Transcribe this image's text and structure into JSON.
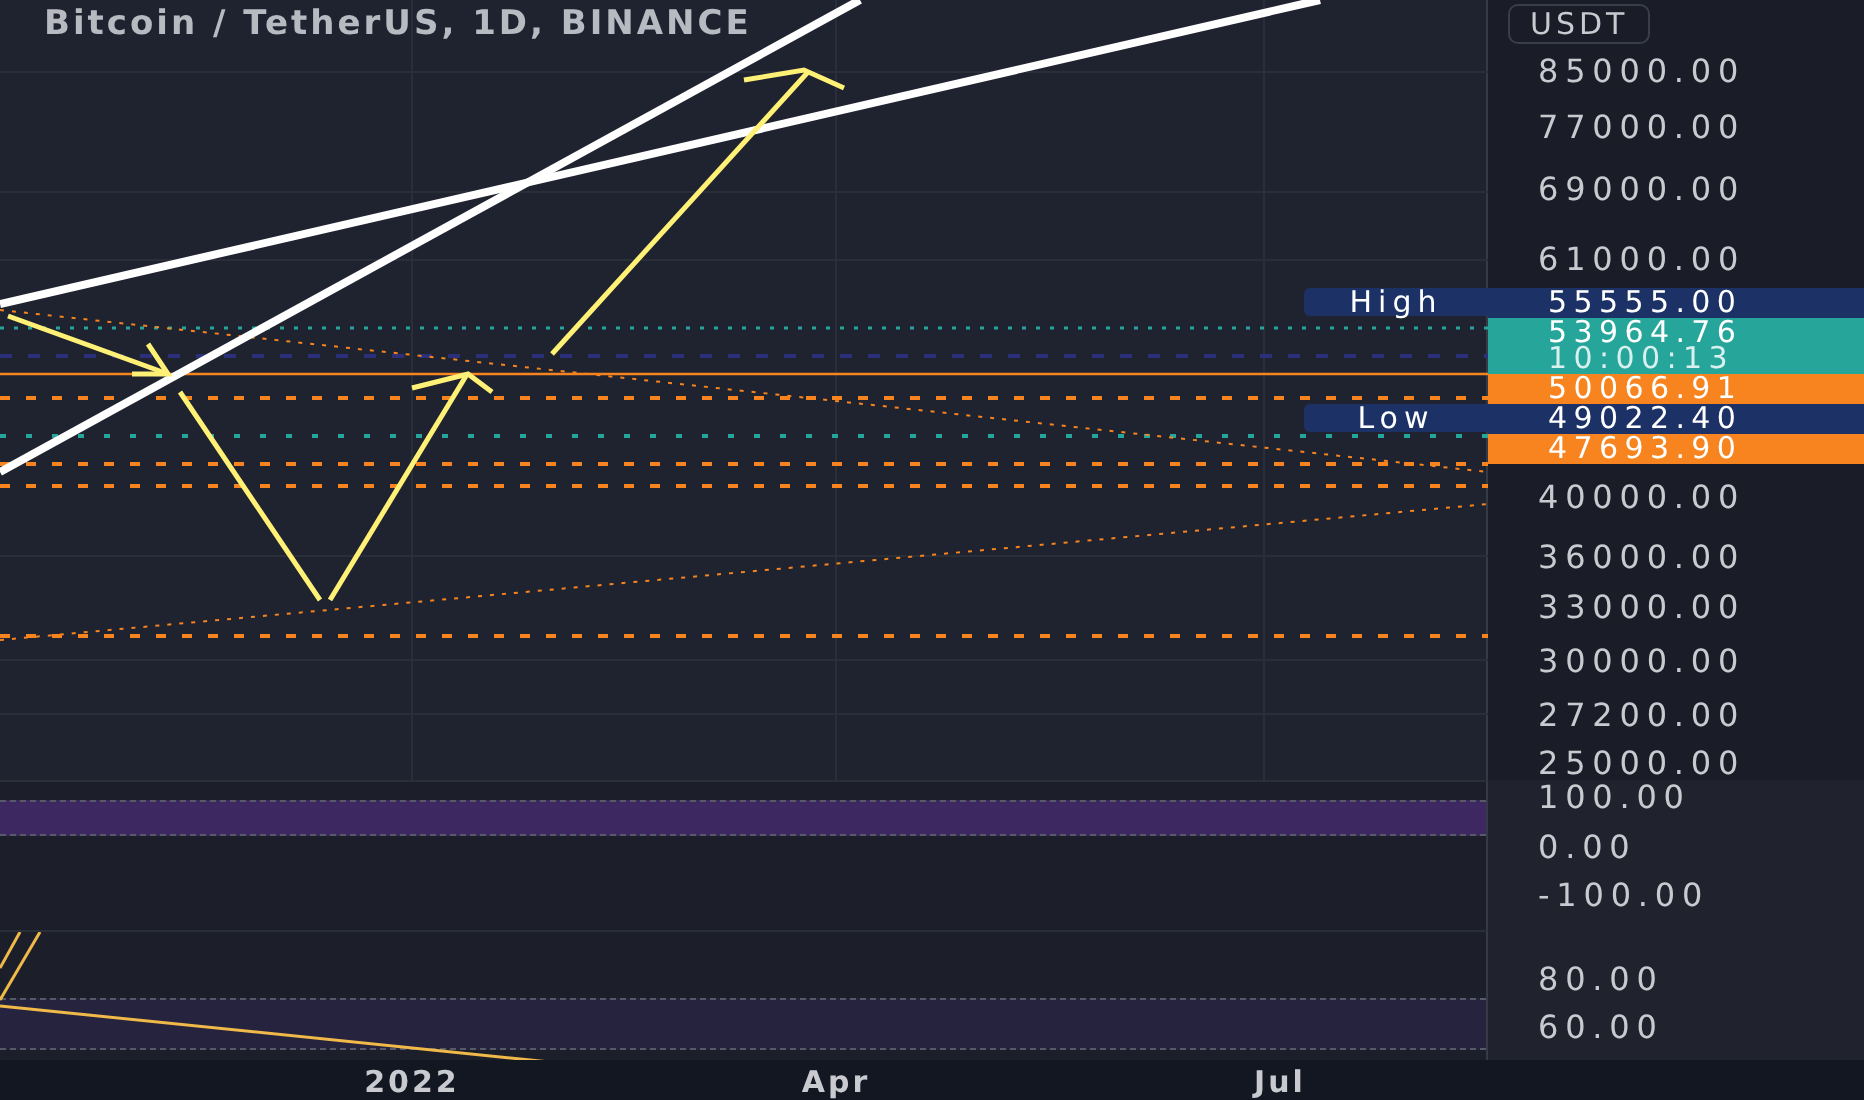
{
  "title": "Bitcoin / TetherUS, 1D, BINANCE",
  "currency": "USDT",
  "price_axis": [
    "85000.00",
    "77000.00",
    "69000.00",
    "61000.00",
    "40000.00",
    "36000.00",
    "33000.00",
    "30000.00",
    "27200.00",
    "25000.00"
  ],
  "price_tags": [
    {
      "label": "High",
      "value": "55555.00",
      "kind": "high-low"
    },
    {
      "value": "53964.76",
      "countdown": "10:00:13",
      "kind": "last"
    },
    {
      "value": "50066.91",
      "kind": "line"
    },
    {
      "label": "Low",
      "value": "49022.40",
      "kind": "high-low"
    },
    {
      "value": "47693.90",
      "kind": "line"
    }
  ],
  "oscillator_axis": [
    "100.00",
    "0.00",
    "-100.00"
  ],
  "rsi_axis": [
    "80.00",
    "60.00"
  ],
  "time_axis": [
    "2022",
    "Apr",
    "Jul"
  ]
}
